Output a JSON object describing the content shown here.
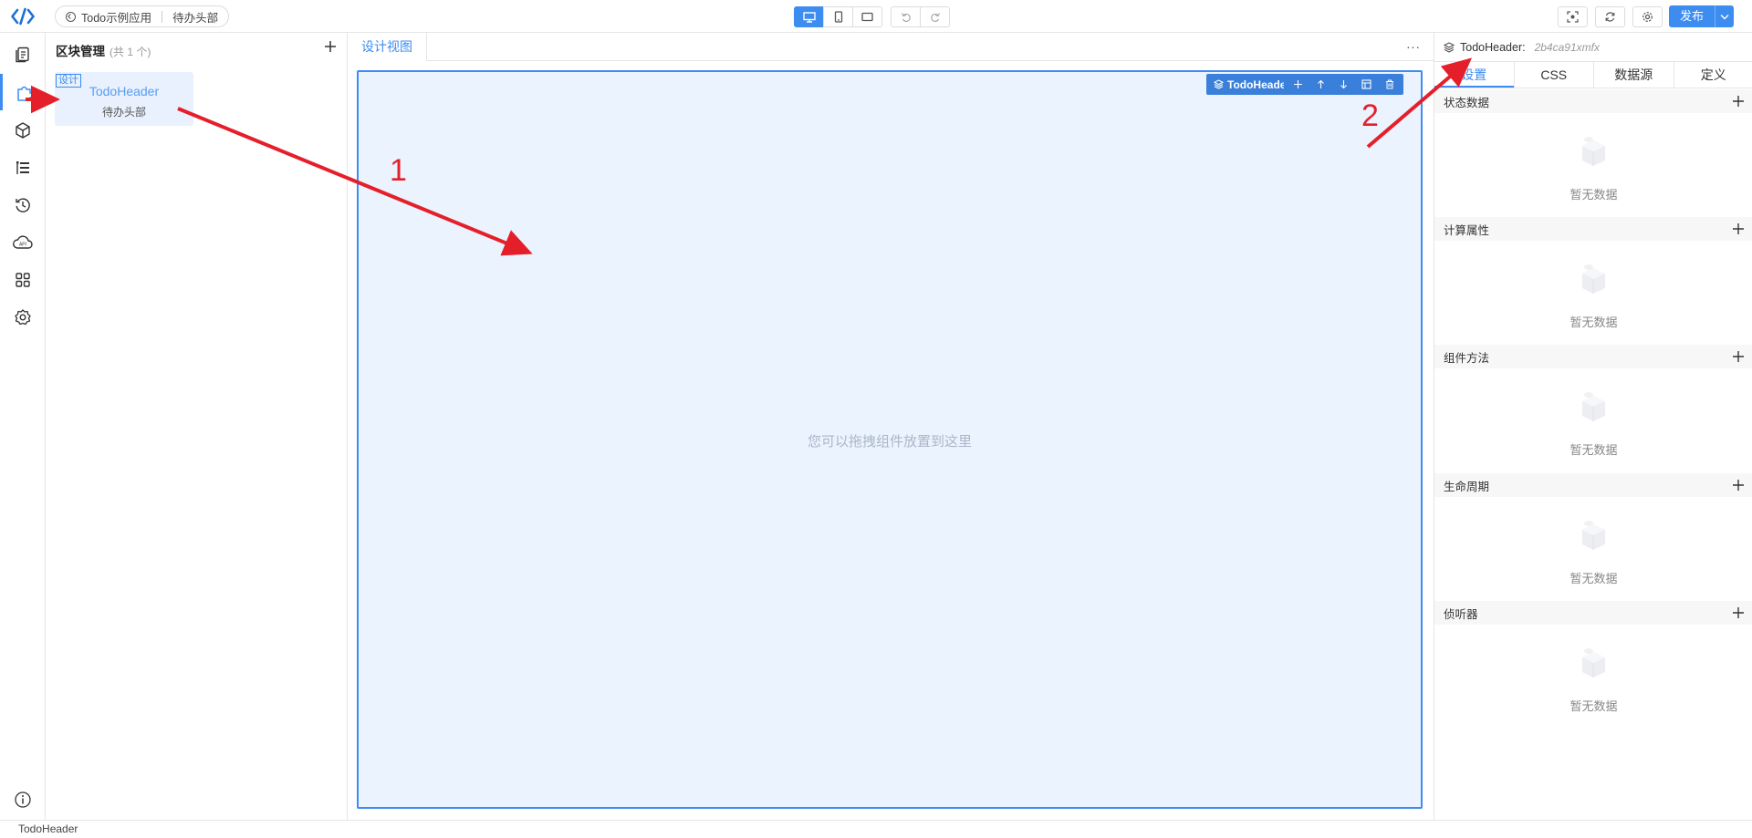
{
  "header": {
    "breadcrumb_app": "Todo示例应用",
    "breadcrumb_page": "待办头部",
    "publish_label": "发布",
    "accent": "#3d8cf0"
  },
  "block_panel": {
    "title": "区块管理",
    "count": "(共 1 个)",
    "block": {
      "tag": "设计",
      "name": "TodoHeader",
      "label": "待办头部"
    }
  },
  "canvas": {
    "tab_label": "设计视图",
    "more": "···",
    "hint": "您可以拖拽组件放置到这里",
    "selected_chip": "TodoHeader"
  },
  "right_panel": {
    "component_name": "TodoHeader:",
    "component_id": "2b4ca91xmfx",
    "tabs": [
      "设置",
      "CSS",
      "数据源",
      "定义"
    ],
    "sections": [
      {
        "title": "状态数据",
        "empty": "暂无数据"
      },
      {
        "title": "计算属性",
        "empty": "暂无数据"
      },
      {
        "title": "组件方法",
        "empty": "暂无数据"
      },
      {
        "title": "生命周期",
        "empty": "暂无数据"
      },
      {
        "title": "侦听器",
        "empty": "暂无数据"
      }
    ]
  },
  "status_bar": {
    "text": "TodoHeader"
  },
  "annotations": {
    "label_1": "1",
    "label_2": "2",
    "color": "#e51f2a"
  },
  "rail_icons": [
    "pages-icon",
    "block-icon",
    "component-icon",
    "outline-icon",
    "history-icon",
    "api-cloud-icon",
    "apps-icon",
    "settings-icon",
    "info-icon"
  ]
}
